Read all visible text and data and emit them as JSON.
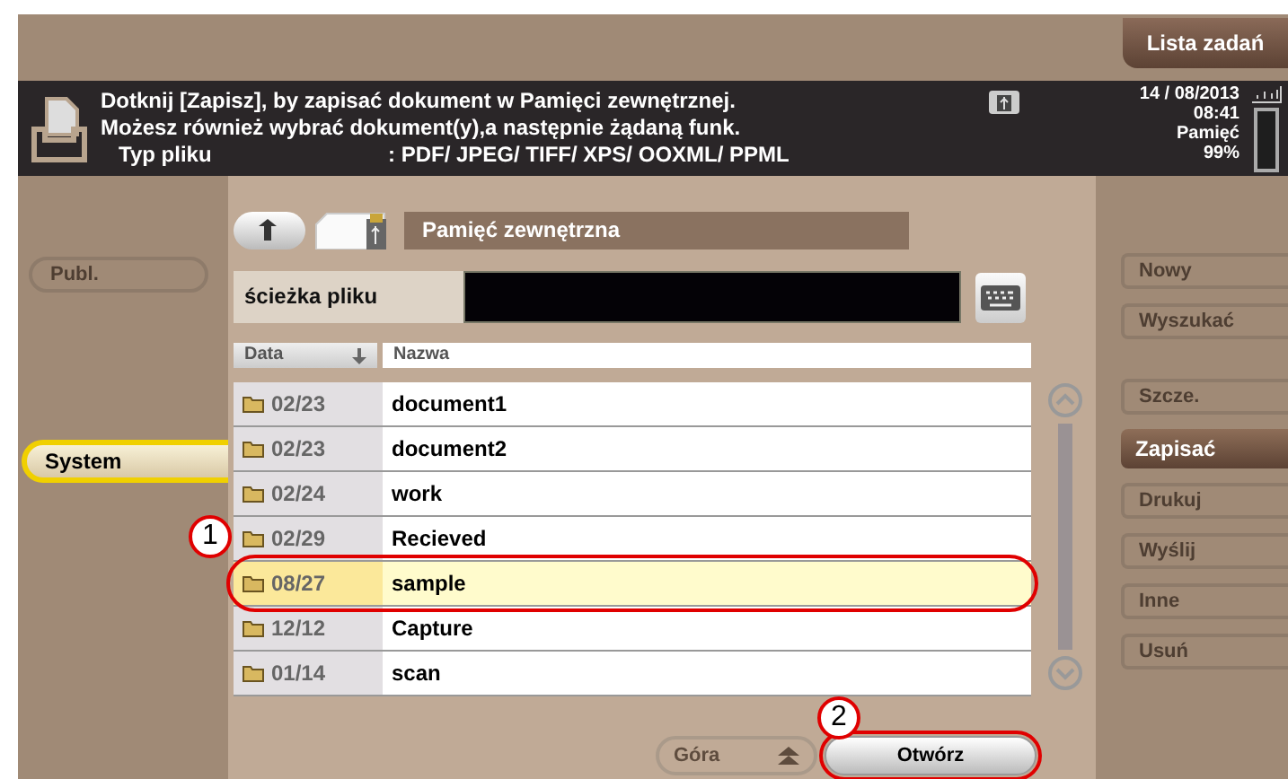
{
  "top_bar": {
    "job_list_button": "Lista zadań"
  },
  "message": {
    "lines": [
      "Dotknij [Zapisz], by zapisać dokument w Pamięci zewnętrznej.",
      "Możesz również wybrać dokument(y),a następnie żądaną funk."
    ],
    "file_type": {
      "label": "Typ pliku",
      "value": ": PDF/ JPEG/ TIFF/ XPS/ OOXML/ PPML"
    }
  },
  "status": {
    "date": "14 / 08/2013",
    "time": "08:41",
    "memory_label": "Pamięć",
    "memory_value": "99%"
  },
  "left_tabs": [
    {
      "label": "Publ.",
      "selected": false,
      "disabled": true
    },
    {
      "label": "System",
      "selected": true,
      "disabled": false
    }
  ],
  "panel": {
    "title": "Pamięć zewnętrzna",
    "path_label": "ścieżka pliku",
    "columns": [
      {
        "label": "Data",
        "sorted": true
      },
      {
        "label": "Nazwa",
        "sorted": false
      }
    ],
    "rows": [
      {
        "date": "02/23",
        "name": "document1",
        "selected": false,
        "annotated": false
      },
      {
        "date": "02/23",
        "name": "document2",
        "selected": false,
        "annotated": false
      },
      {
        "date": "02/24",
        "name": "work",
        "selected": false,
        "annotated": false
      },
      {
        "date": "02/29",
        "name": "Recieved",
        "selected": false,
        "annotated": false
      },
      {
        "date": "08/27",
        "name": "sample",
        "selected": true,
        "annotated": true
      },
      {
        "date": "12/12",
        "name": "Capture",
        "selected": false,
        "annotated": false
      },
      {
        "date": "01/14",
        "name": "scan",
        "selected": false,
        "annotated": false
      }
    ],
    "top_button": {
      "label": "Góra",
      "disabled": true
    },
    "open_button": {
      "label": "Otwórz",
      "disabled": false,
      "annotated": true
    }
  },
  "right_menu": [
    {
      "label": "Nowy",
      "selected": false,
      "disabled": true
    },
    {
      "label": "Wyszukać",
      "selected": false,
      "disabled": true
    },
    {
      "label": "Szcze.",
      "selected": false,
      "disabled": true
    },
    {
      "label": "Zapisać",
      "selected": true,
      "disabled": false
    },
    {
      "label": "Drukuj",
      "selected": false,
      "disabled": true
    },
    {
      "label": "Wyślij",
      "selected": false,
      "disabled": true
    },
    {
      "label": "Inne",
      "selected": false,
      "disabled": true
    },
    {
      "label": "Usuń",
      "selected": false,
      "disabled": true
    }
  ],
  "callouts": [
    {
      "number": "1"
    },
    {
      "number": "2"
    }
  ]
}
